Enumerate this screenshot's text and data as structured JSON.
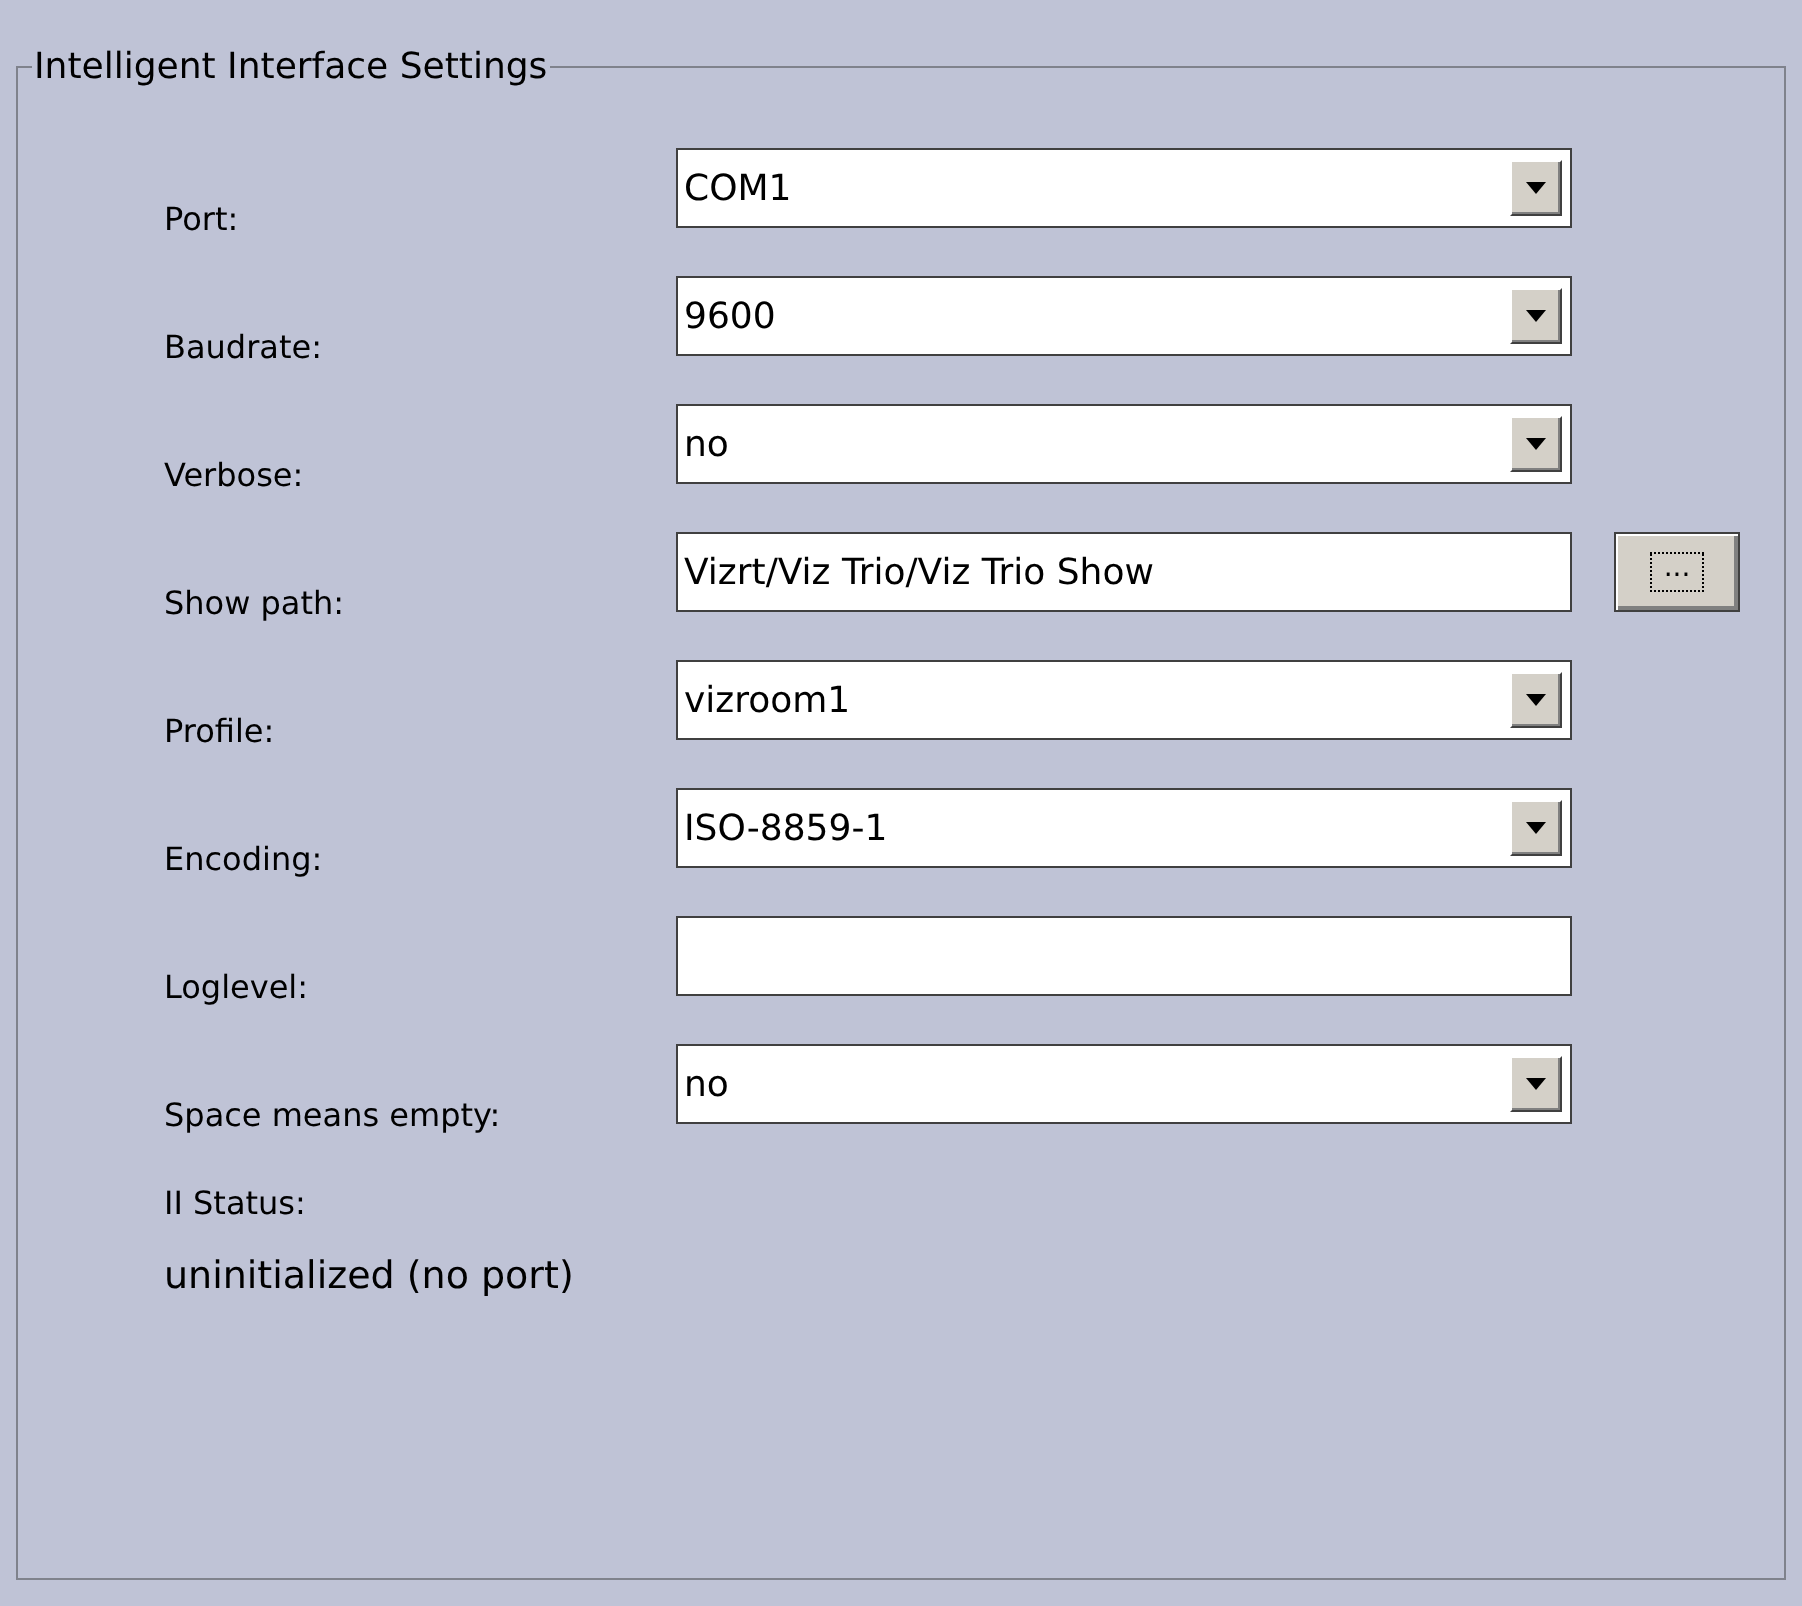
{
  "group": {
    "title": "Intelligent Interface Settings"
  },
  "fields": [
    {
      "kind": "dropdown",
      "label": "Port:",
      "value": "COM1"
    },
    {
      "kind": "dropdown",
      "label": "Baudrate:",
      "value": "9600"
    },
    {
      "kind": "dropdown",
      "label": "Verbose:",
      "value": "no"
    },
    {
      "kind": "path",
      "label": "Show path:",
      "value": "Vizrt/Viz Trio/Viz Trio Show",
      "button": "..."
    },
    {
      "kind": "dropdown",
      "label": "Profile:",
      "value": "vizroom1"
    },
    {
      "kind": "dropdown",
      "label": "Encoding:",
      "value": "ISO-8859-1"
    },
    {
      "kind": "text",
      "label": "Loglevel:"
    },
    {
      "kind": "dropdown",
      "label": "Space means empty:",
      "value": "no"
    }
  ],
  "status": {
    "label": "II Status:",
    "value": "uninitialized (no port)"
  }
}
